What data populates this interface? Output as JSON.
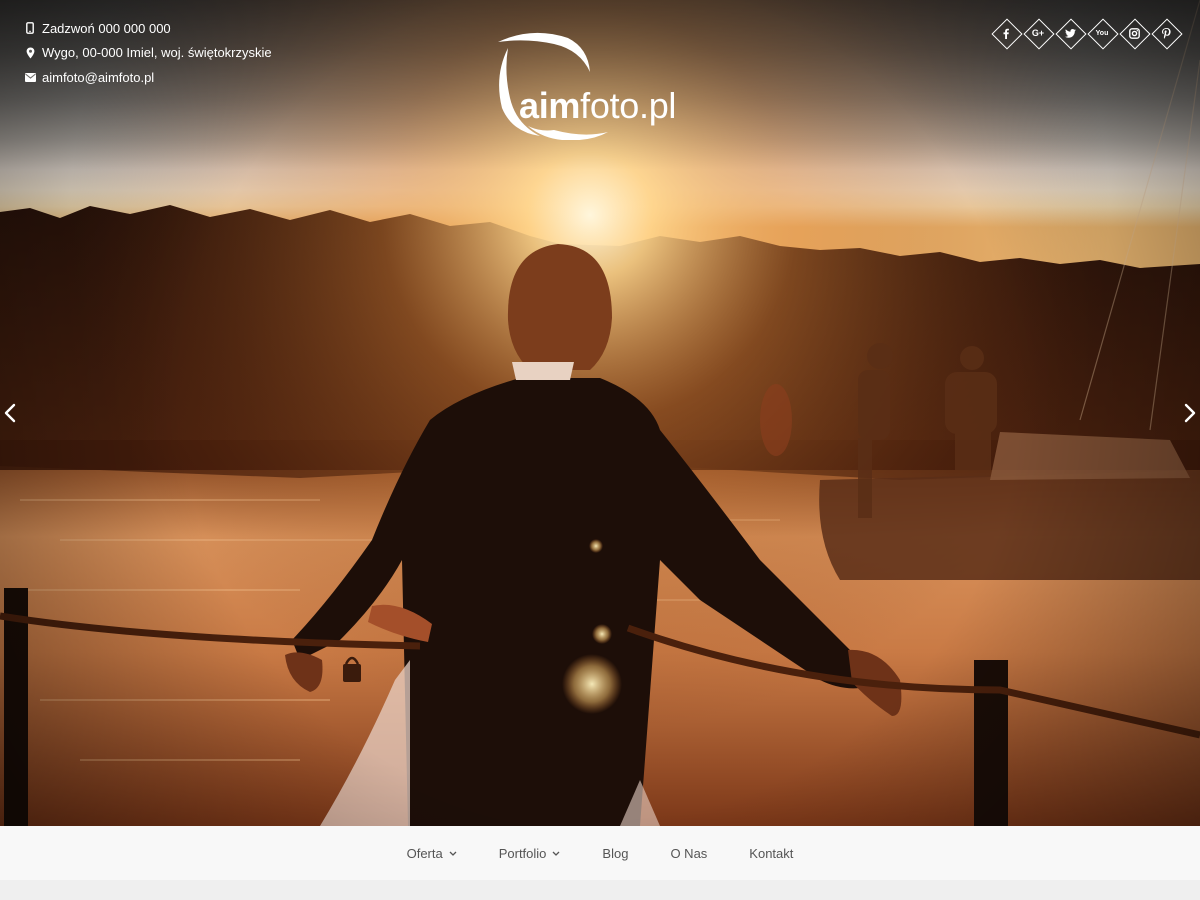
{
  "contact": {
    "phone": "Zadzwoń 000 000 000",
    "address": "Wygo, 00-000 Imiel, woj. świętokrzyskie",
    "email": "aimfoto@aimfoto.pl"
  },
  "logo": {
    "bold": "aim",
    "light": "foto.pl"
  },
  "social": [
    "facebook-icon",
    "google-plus-icon",
    "twitter-icon",
    "youtube-icon",
    "instagram-icon",
    "pinterest-icon"
  ],
  "social_labels": {
    "google": "G+",
    "youtube": "You"
  },
  "nav": {
    "items": [
      {
        "label": "Oferta",
        "dropdown": true
      },
      {
        "label": "Portfolio",
        "dropdown": true
      },
      {
        "label": "Blog",
        "dropdown": false
      },
      {
        "label": "O Nas",
        "dropdown": false
      },
      {
        "label": "Kontakt",
        "dropdown": false
      }
    ]
  },
  "colors": {
    "nav_bg": "#f8f8f8",
    "nav_text": "#555555",
    "overlay_text": "#ffffff"
  }
}
